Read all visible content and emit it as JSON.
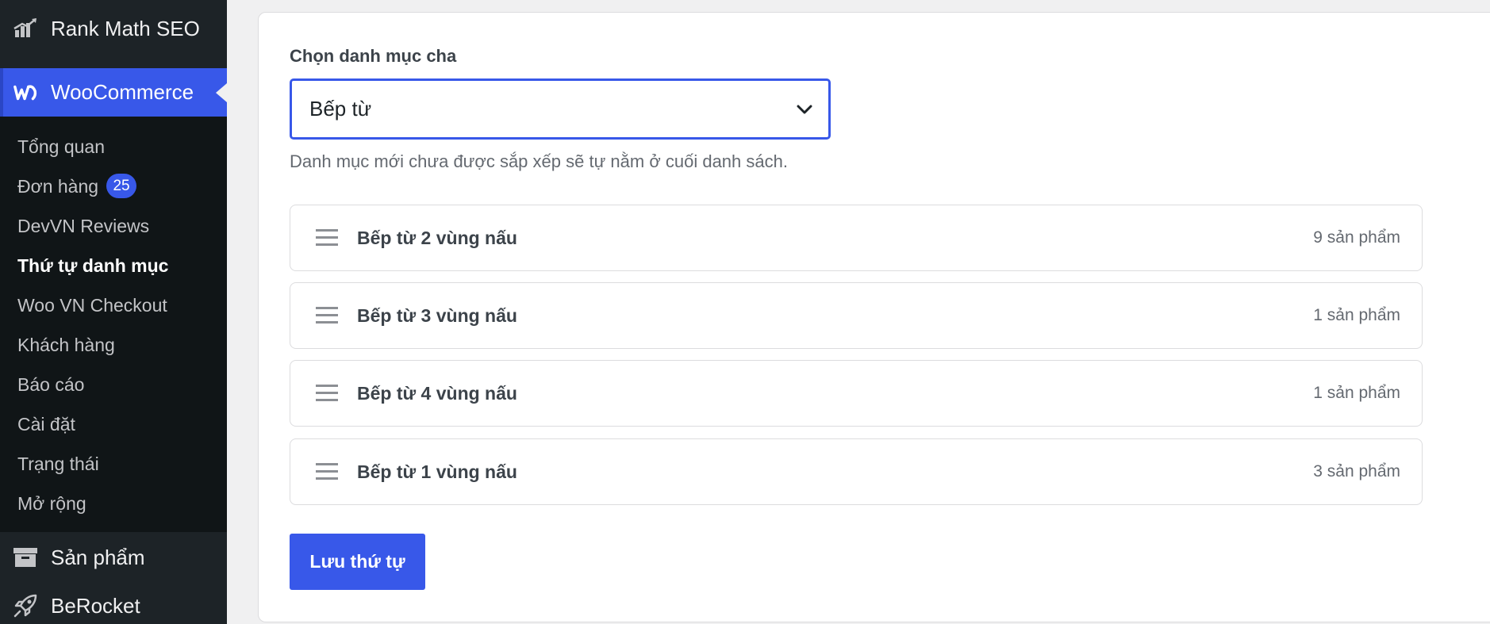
{
  "sidebar": {
    "top_items": {
      "rank_math": {
        "label": "Rank Math SEO",
        "icon": "rank-math-icon"
      },
      "woocommerce": {
        "label": "WooCommerce",
        "icon": "woocommerce-icon"
      },
      "san_pham": {
        "label": "Sản phẩm",
        "icon": "archive-box-icon"
      },
      "berocket": {
        "label": "BeRocket",
        "icon": "rocket-icon"
      }
    },
    "submenu": [
      {
        "label": "Tổng quan"
      },
      {
        "label": "Đơn hàng",
        "badge": "25"
      },
      {
        "label": "DevVN Reviews"
      },
      {
        "label": "Thứ tự danh mục",
        "current": true
      },
      {
        "label": "Woo VN Checkout"
      },
      {
        "label": "Khách hàng"
      },
      {
        "label": "Báo cáo"
      },
      {
        "label": "Cài đặt"
      },
      {
        "label": "Trạng thái"
      },
      {
        "label": "Mở rộng"
      }
    ]
  },
  "main": {
    "parent_label": "Chọn danh mục cha",
    "parent_select": {
      "value": "Bếp từ"
    },
    "hint": "Danh mục mới chưa được sắp xếp sẽ tự nằm ở cuối danh sách.",
    "categories": [
      {
        "name": "Bếp từ 2 vùng nấu",
        "count": "9 sản phẩm"
      },
      {
        "name": "Bếp từ 3 vùng nấu",
        "count": "1 sản phẩm"
      },
      {
        "name": "Bếp từ 4 vùng nấu",
        "count": "1 sản phẩm"
      },
      {
        "name": "Bếp từ 1 vùng nấu",
        "count": "3 sản phẩm"
      }
    ],
    "save_label": "Lưu thứ tự"
  },
  "colors": {
    "accent": "#3858e9",
    "sidebar_bg": "#1d2327",
    "submenu_bg": "#101517",
    "page_bg": "#f0f0f1"
  }
}
